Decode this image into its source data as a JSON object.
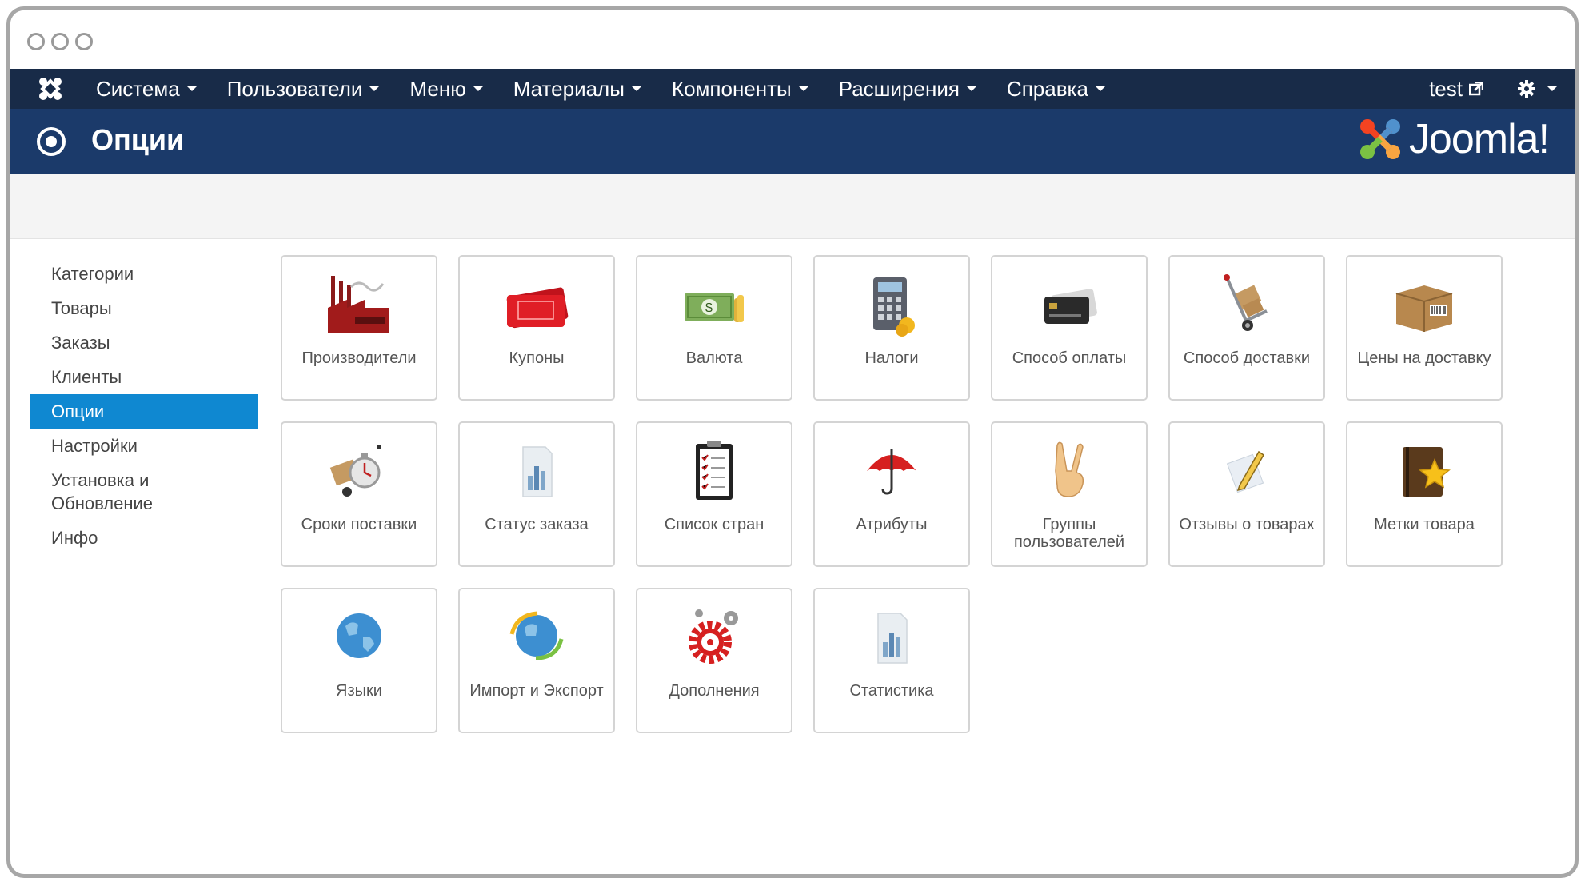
{
  "topnav": {
    "menu": [
      {
        "label": "Система"
      },
      {
        "label": "Пользователи"
      },
      {
        "label": "Меню"
      },
      {
        "label": "Материалы"
      },
      {
        "label": "Компоненты"
      },
      {
        "label": "Расширения"
      },
      {
        "label": "Справка"
      }
    ],
    "user": "test"
  },
  "header": {
    "title": "Опции",
    "brand": "Joomla!"
  },
  "sidebar": {
    "items": [
      {
        "label": "Категории"
      },
      {
        "label": "Товары"
      },
      {
        "label": "Заказы"
      },
      {
        "label": "Клиенты"
      },
      {
        "label": "Опции",
        "active": true
      },
      {
        "label": "Настройки"
      },
      {
        "label": "Установка и Обновление"
      },
      {
        "label": "Инфо"
      }
    ]
  },
  "tiles": [
    {
      "label": "Производители",
      "icon": "factory-icon"
    },
    {
      "label": "Купоны",
      "icon": "coupon-icon"
    },
    {
      "label": "Валюта",
      "icon": "money-icon"
    },
    {
      "label": "Налоги",
      "icon": "calculator-icon"
    },
    {
      "label": "Способ оплаты",
      "icon": "credit-card-icon"
    },
    {
      "label": "Способ доставки",
      "icon": "hand-truck-icon"
    },
    {
      "label": "Цены на доставку",
      "icon": "package-icon"
    },
    {
      "label": "Сроки поставки",
      "icon": "stopwatch-icon"
    },
    {
      "label": "Статус заказа",
      "icon": "bar-chart-document-icon"
    },
    {
      "label": "Список стран",
      "icon": "clipboard-list-icon"
    },
    {
      "label": "Атрибуты",
      "icon": "umbrella-icon"
    },
    {
      "label": "Группы пользователей",
      "icon": "victory-hand-icon"
    },
    {
      "label": "Отзывы о товарах",
      "icon": "pencil-note-icon"
    },
    {
      "label": "Метки товара",
      "icon": "book-star-icon"
    },
    {
      "label": "Языки",
      "icon": "globe-icon"
    },
    {
      "label": "Импорт и Экспорт",
      "icon": "globe-arrows-icon"
    },
    {
      "label": "Дополнения",
      "icon": "gears-icon"
    },
    {
      "label": "Статистика",
      "icon": "statistics-icon"
    }
  ],
  "colors": {
    "navbar": "#182b48",
    "header": "#1b3a6a",
    "active": "#0f88d1"
  }
}
